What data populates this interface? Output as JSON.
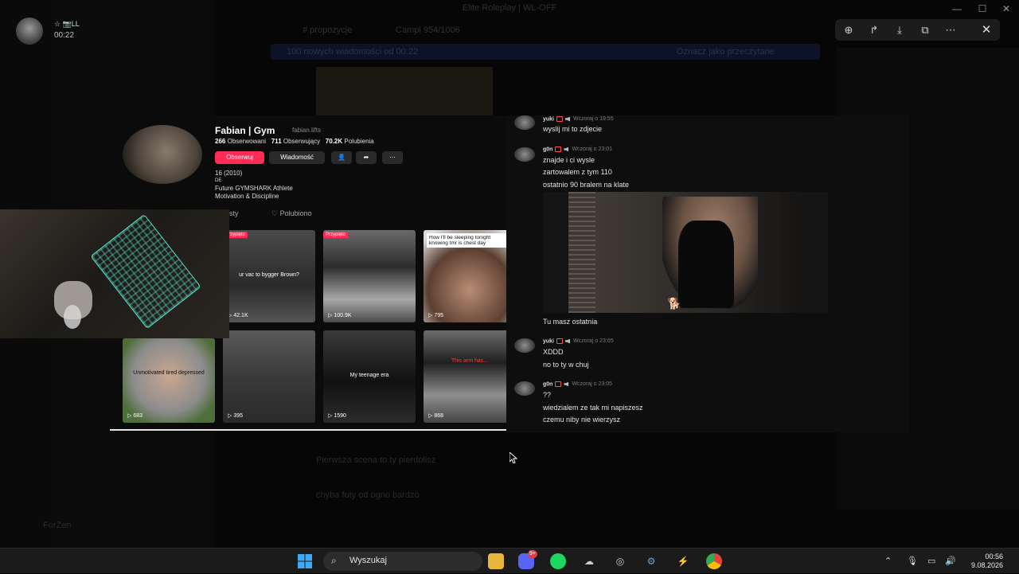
{
  "window": {
    "title": "Elite Roleplay | WL-OFF",
    "controls": {
      "minimize": "—",
      "maximize": "☐",
      "close": "✕"
    }
  },
  "viewer": {
    "badges": "☆ 📷LL",
    "time": "00:22",
    "bg_channel": "Elite Roleplay | WL-OFF",
    "toolbar": {
      "zoom_icon": "⊕",
      "forward_icon": "↱",
      "download_icon": "⤓",
      "open_icon": "⧉",
      "more_icon": "⋯"
    },
    "close_icon": "✕"
  },
  "background": {
    "channel_header": "# propozycje",
    "channel_count": "Campi 954/1006",
    "banner": "100 nowych wiadomości od 00:22",
    "banner_right": "Oznacz jako przeczytane",
    "msg_line_1": "Pierwsza scena to ty pierdolisz",
    "msg_line_2": "chyba foty od ogno bardzo",
    "sidebar_bottom": "ForZen"
  },
  "tiktok": {
    "name": "Fabian | Gym",
    "handle": "fabian.lifts",
    "stats": {
      "following_count": "266",
      "following_label": "Obserwowani",
      "followers_count": "711",
      "followers_label": "Obserwujący",
      "likes_count": "70.2K",
      "likes_label": "Polubienia"
    },
    "buttons": {
      "follow": "Obserwuj",
      "message": "Wiadomość",
      "add_icon": "👤",
      "share_icon": "➦",
      "more_icon": "⋯"
    },
    "bio": [
      "16 (2010)",
      "DE",
      "Future GYMSHARK Athlete",
      "Motivation & Discipline"
    ],
    "tabs": {
      "posts": "sty",
      "liked": "♡ Polubiono"
    },
    "videos": [
      {
        "views": "▷ 42.1K",
        "pinned": "Przypięto",
        "caption": "",
        "mid": "ur vac to bygger Brown?"
      },
      {
        "views": "▷ 100.9K",
        "pinned": "Przypięto",
        "caption": "",
        "mid": ""
      },
      {
        "views": "▷ 795",
        "pinned": "",
        "caption": "How I'll be sleeping tonight knowing tmr is chest day",
        "mid": ""
      },
      {
        "views": "▷ 683",
        "pinned": "",
        "caption": "",
        "mid": "Unmotivated tired depressed"
      },
      {
        "views": "▷ 395",
        "pinned": "",
        "caption": "",
        "mid": ""
      },
      {
        "views": "▷ 1590",
        "pinned": "",
        "caption": "",
        "mid": "My teenage era"
      },
      {
        "views": "▷ 868",
        "pinned": "",
        "caption": "",
        "mid": "This arm has..."
      }
    ]
  },
  "chat": {
    "messages": [
      {
        "author": "yuki",
        "time": "Wczoraj o 19:55",
        "lines": [
          "wyslij mi to zdjecie"
        ]
      },
      {
        "author": "g0n",
        "time": "Wczoraj o 23:01",
        "lines": [
          "znajde i ci wysle",
          "zartowalem z tym 110",
          "ostatnio 90 bralem na klate"
        ]
      },
      {
        "caption": "Tu masz ostatnia"
      },
      {
        "author": "yuki",
        "time": "Wczoraj o 23:05",
        "lines": [
          "XDDD",
          "no to ty w chuj"
        ]
      },
      {
        "author": "g0n",
        "time": "Wczoraj o 23:05",
        "lines": [
          "??",
          "wiedzialem ze tak mi napiszesz",
          "czemu niby nie wierzysz"
        ]
      }
    ]
  },
  "taskbar": {
    "search_label": "Wyszukaj",
    "time": "00:56",
    "date": "9.08.2026",
    "discord_badge": "9+"
  }
}
